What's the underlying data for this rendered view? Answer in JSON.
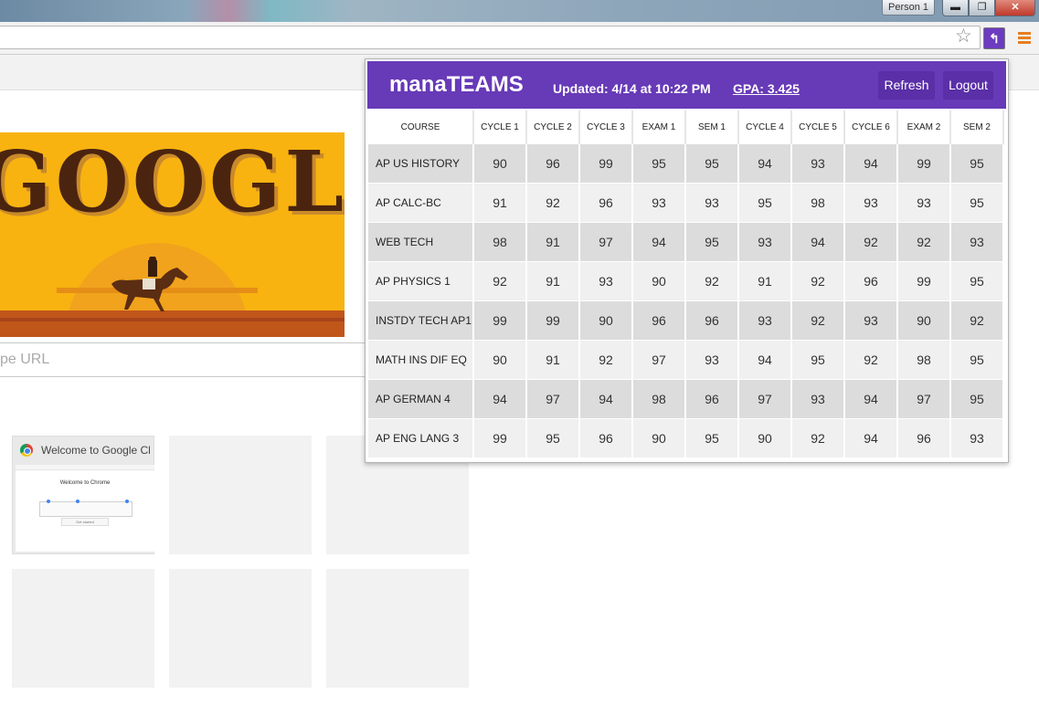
{
  "window": {
    "profile_label": "Person 1",
    "min_label": "▬",
    "restore_label": "❐",
    "close_label": "✕"
  },
  "toolbar": {
    "star_icon": "star-icon",
    "star_glyph": "☆",
    "extension_icon": "manateams-extension-icon",
    "extension_glyph": "↰",
    "menu_icon": "chrome-menu-icon"
  },
  "ntp": {
    "doodle_text": "GOOGLE",
    "omnibox_placeholder": "pe URL",
    "tiles": [
      {
        "title": "Welcome to Google Chrome"
      }
    ],
    "thumb": {
      "heading": "Welcome to Chrome",
      "button": "Get started"
    }
  },
  "popup": {
    "brand": "manaTEAMS",
    "updated": "Updated: 4/14 at 10:22 PM",
    "gpa": "GPA: 3.425",
    "refresh_label": "Refresh",
    "logout_label": "Logout",
    "columns": [
      "COURSE",
      "CYCLE 1",
      "CYCLE 2",
      "CYCLE 3",
      "EXAM 1",
      "SEM 1",
      "CYCLE 4",
      "CYCLE 5",
      "CYCLE 6",
      "EXAM 2",
      "SEM 2"
    ],
    "rows": [
      {
        "course": "AP US HISTORY",
        "grades": [
          "90",
          "96",
          "99",
          "95",
          "95",
          "94",
          "93",
          "94",
          "99",
          "95"
        ]
      },
      {
        "course": "AP CALC-BC",
        "grades": [
          "91",
          "92",
          "96",
          "93",
          "93",
          "95",
          "98",
          "93",
          "93",
          "95"
        ]
      },
      {
        "course": "WEB TECH",
        "grades": [
          "98",
          "91",
          "97",
          "94",
          "95",
          "93",
          "94",
          "92",
          "92",
          "93"
        ]
      },
      {
        "course": "AP PHYSICS 1",
        "grades": [
          "92",
          "91",
          "93",
          "90",
          "92",
          "91",
          "92",
          "96",
          "99",
          "95"
        ]
      },
      {
        "course": "INSTDY TECH AP1",
        "grades": [
          "99",
          "99",
          "90",
          "96",
          "96",
          "93",
          "92",
          "93",
          "90",
          "92"
        ]
      },
      {
        "course": "MATH INS DIF EQ",
        "grades": [
          "90",
          "91",
          "92",
          "97",
          "93",
          "94",
          "95",
          "92",
          "98",
          "95"
        ]
      },
      {
        "course": "AP GERMAN 4",
        "grades": [
          "94",
          "97",
          "94",
          "98",
          "96",
          "97",
          "93",
          "94",
          "97",
          "95"
        ]
      },
      {
        "course": "AP ENG LANG 3",
        "grades": [
          "99",
          "95",
          "96",
          "90",
          "95",
          "90",
          "92",
          "94",
          "96",
          "93"
        ]
      }
    ]
  }
}
